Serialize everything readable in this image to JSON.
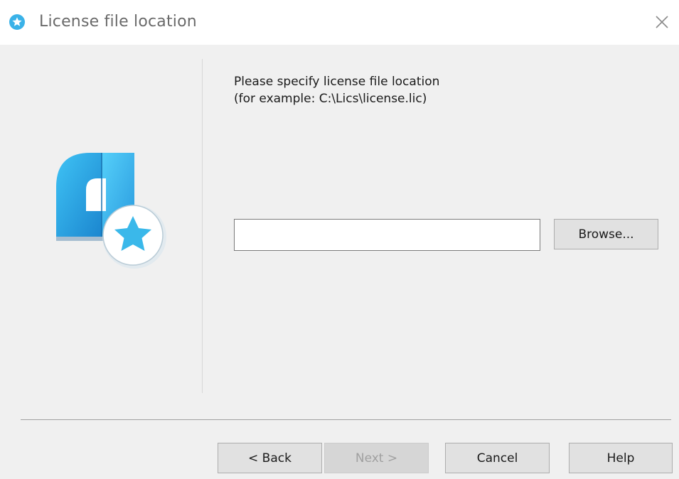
{
  "window": {
    "title": "License file location",
    "close_icon": "close-icon",
    "app_icon": "star-badge-icon"
  },
  "main": {
    "instruction_line1": "Please specify license file location",
    "instruction_line2": "(for example: C:\\Lics\\license.lic)",
    "path_input": {
      "value": "",
      "placeholder": ""
    },
    "browse_label": "Browse..."
  },
  "footer": {
    "back_label": "< Back",
    "next_label": "Next >",
    "next_enabled": false,
    "cancel_label": "Cancel",
    "help_label": "Help"
  },
  "colors": {
    "accent_blue": "#3ab2e8",
    "logo_dark": "#1f7fc0",
    "background": "#f0f0f0",
    "titlebar": "#ffffff"
  }
}
